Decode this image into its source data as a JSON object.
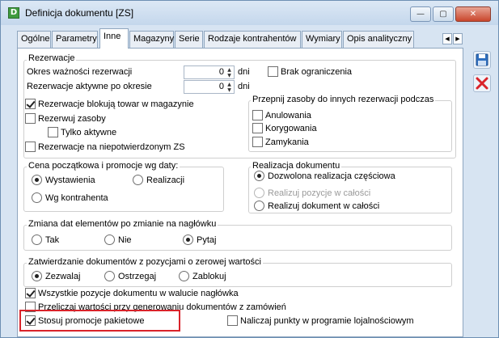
{
  "window": {
    "title": "Definicja dokumentu [ZS]",
    "icon": "document-app-icon"
  },
  "title_buttons": {
    "minimize": "—",
    "maximize": "▢",
    "close": "✕"
  },
  "tabs": [
    "Ogólne",
    "Parametry",
    "Inne",
    "Magazyny",
    "Serie",
    "Rodzaje kontrahentów",
    "Wymiary",
    "Opis analityczny"
  ],
  "active_tab": "Inne",
  "tab_scroll": {
    "left": "◀",
    "right": "▶"
  },
  "reservations": {
    "title": "Rezerwacje",
    "validity_label": "Okres ważności rezerwacji",
    "validity_value": "0",
    "validity_unit": "dni",
    "no_limit_label": "Brak ograniczenia",
    "active_after_label": "Rezerwacje aktywne po okresie",
    "active_after_value": "0",
    "active_after_unit": "dni",
    "block_goods_label": "Rezerwacje blokują towar w magazynie",
    "reserve_resources_label": "Rezerwuj zasoby",
    "only_active_label": "Tylko aktywne",
    "unconfirmed_label": "Rezerwacje na niepotwierdzonym ZS",
    "reassign": {
      "title": "Przepnij zasoby do innych rezerwacji podczas",
      "cancel_label": "Anulowania",
      "correct_label": "Korygowania",
      "close_label": "Zamykania"
    }
  },
  "price": {
    "title": "Cena początkowa i promocje wg daty:",
    "issue_label": "Wystawienia",
    "realization_label": "Realizacji",
    "contractor_label": "Wg kontrahenta"
  },
  "realization": {
    "title": "Realizacja dokumentu",
    "partial_label": "Dozwolona realizacja częściowa",
    "whole_item_label": "Realizuj pozycje w całości",
    "whole_doc_label": "Realizuj dokument w całości"
  },
  "date_change": {
    "title": "Zmiana dat elementów po zmianie na nagłówku",
    "yes_label": "Tak",
    "no_label": "Nie",
    "ask_label": "Pytaj"
  },
  "zero_value": {
    "title": "Zatwierdzanie dokumentów z pozycjami o zerowej wartości",
    "allow_label": "Zezwalaj",
    "warn_label": "Ostrzegaj",
    "block_label": "Zablokuj"
  },
  "options": {
    "header_currency_label": "Wszystkie pozycje dokumentu w walucie nagłówka",
    "recalc_label": "Przeliczaj wartości przy generowaniu dokumentów z zamówień",
    "package_promo_label": "Stosuj promocje pakietowe",
    "loyalty_label": "Naliczaj punkty w programie lojalnościowym"
  },
  "side_buttons": {
    "save": "save-icon",
    "cancel": "cancel-icon"
  },
  "colors": {
    "highlight": "#d9232a",
    "window_bg": "#d7e4f2",
    "cancel_red": "#d9232a",
    "save_blue": "#2f6fbf"
  }
}
